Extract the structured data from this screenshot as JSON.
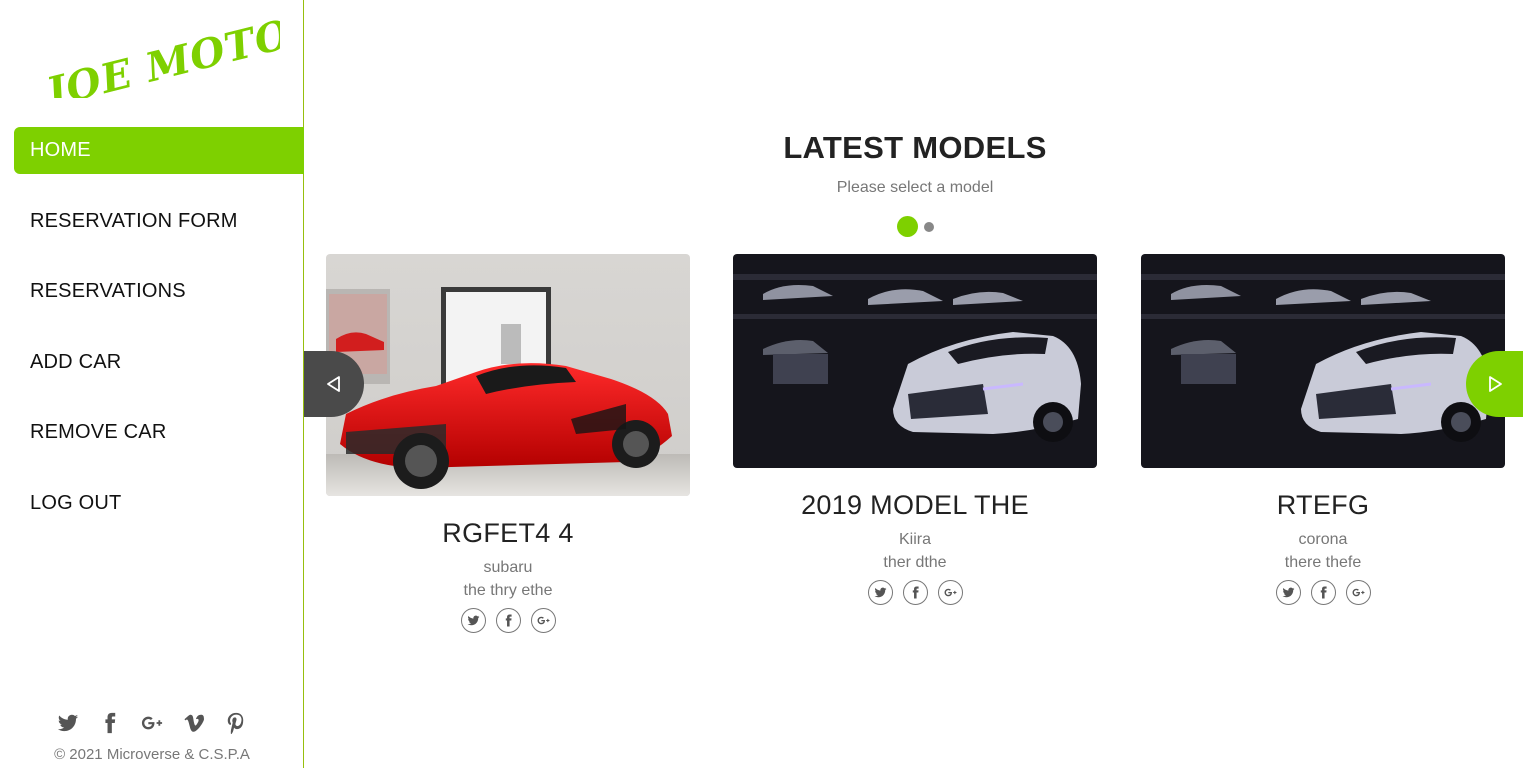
{
  "brand": {
    "logo_text": "JOE MOTORS"
  },
  "nav": {
    "items": [
      {
        "label": "HOME",
        "active": true
      },
      {
        "label": "RESERVATION FORM",
        "active": false
      },
      {
        "label": "RESERVATIONS",
        "active": false
      },
      {
        "label": "ADD CAR",
        "active": false
      },
      {
        "label": "REMOVE CAR",
        "active": false
      },
      {
        "label": "LOG OUT",
        "active": false
      }
    ]
  },
  "footer": {
    "social_icons": [
      "twitter-icon",
      "facebook-icon",
      "google-plus-icon",
      "vimeo-icon",
      "pinterest-icon"
    ],
    "copyright": "© 2021 Microverse & C.S.P.A"
  },
  "main": {
    "heading": "LATEST MODELS",
    "subheading": "Please select a model",
    "carousel": {
      "pages": 2,
      "current": 1
    },
    "cars": [
      {
        "name": "RGFET4 4",
        "brand": "subaru",
        "description": "the thry ethe",
        "image": "red-sports-car"
      },
      {
        "name": "2019 MODEL THE",
        "brand": "Kiira",
        "description": "ther dthe",
        "image": "white-camaro-garage"
      },
      {
        "name": "RTEFG",
        "brand": "corona",
        "description": "there thefe",
        "image": "white-camaro-garage"
      }
    ],
    "card_social_icons": [
      "twitter-icon",
      "facebook-icon",
      "google-plus-icon"
    ]
  },
  "colors": {
    "accent": "#7ed000",
    "prev_arrow": "#4a4a4a",
    "text_muted": "#777777"
  }
}
